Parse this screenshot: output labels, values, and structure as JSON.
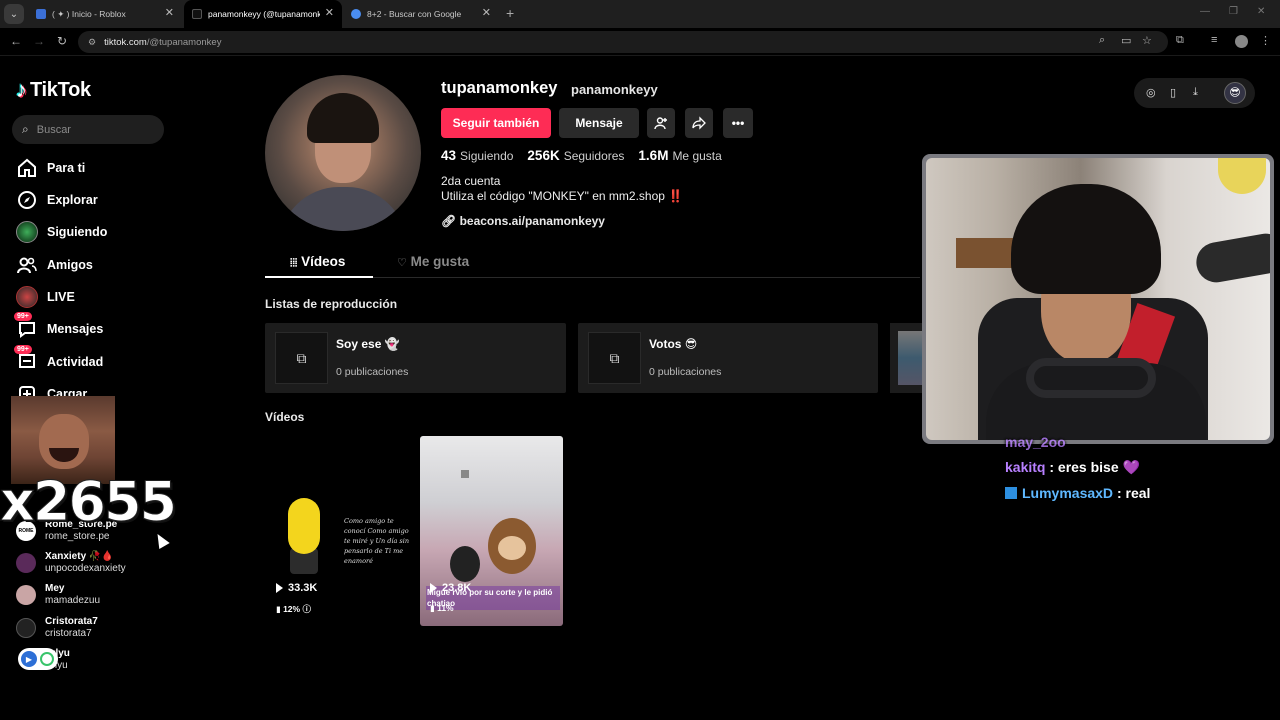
{
  "browser": {
    "tabs": [
      {
        "title": "( ✦ ) Inicio - Roblox",
        "favicon_color": "#3b6fd6"
      },
      {
        "title": "panamonkeyy (@tupanamonkey",
        "favicon_color": "#000000"
      },
      {
        "title": "8+2 - Buscar con Google",
        "favicon_color": "#4a8df0"
      }
    ],
    "url_host": "tiktok.com",
    "url_path": "/@tupanamonkey"
  },
  "sidebar": {
    "logo": "TikTok",
    "search_placeholder": "Buscar",
    "items": [
      {
        "label": "Para ti",
        "icon": "home-icon"
      },
      {
        "label": "Explorar",
        "icon": "compass-icon"
      },
      {
        "label": "Siguiendo",
        "icon": "following-avatar-icon"
      },
      {
        "label": "Amigos",
        "icon": "friends-icon"
      },
      {
        "label": "LIVE",
        "icon": "live-icon"
      },
      {
        "label": "Mensajes",
        "icon": "messages-icon",
        "badge": "99+"
      },
      {
        "label": "Actividad",
        "icon": "activity-icon",
        "badge": "99+"
      },
      {
        "label": "Cargar",
        "icon": "upload-icon"
      }
    ],
    "following": [
      {
        "name": "Rome_store.pe",
        "handle": "rome_store.pe",
        "color": "#ffffff"
      },
      {
        "name": "Xanxiety 🥀🩸",
        "handle": "unpocodexanxiety",
        "color": "#5a2a5a"
      },
      {
        "name": "Mey",
        "handle": "mamadezuu",
        "color": "#c9a5a5"
      },
      {
        "name": "Cristorata7",
        "handle": "cristorata7",
        "color": "#222222"
      },
      {
        "name": "arlyu",
        "handle": "arlyu",
        "color": "#444444"
      }
    ]
  },
  "overlay": {
    "counter": "x2655"
  },
  "profile": {
    "username": "tupanamonkey",
    "nickname": "panamonkeyy",
    "follow_label": "Seguir también",
    "message_label": "Mensaje",
    "stats": {
      "following_count": "43",
      "following_label": "Siguiendo",
      "followers_count": "256K",
      "followers_label": "Seguidores",
      "likes_count": "1.6M",
      "likes_label": "Me gusta"
    },
    "bio_line1": "2da cuenta",
    "bio_line2": "Utiliza el código \"MONKEY\" en mm2.shop",
    "bio_bang": "‼️",
    "link": "beacons.ai/panamonkeyy",
    "tab_videos": "Vídeos",
    "tab_likes": "Me gusta"
  },
  "playlists": {
    "title": "Listas de reproducción",
    "items": [
      {
        "name": "Soy ese 👻",
        "count": "0 publicaciones"
      },
      {
        "name": "Votos 😎",
        "count": "0 publicaciones"
      }
    ]
  },
  "videos": {
    "title": "Vídeos",
    "items": [
      {
        "views": "33.3K",
        "pct": "12%",
        "caption": "Como amigo te conocí Como amigo te miré y Un día sin pensarlo de Ti me enamoré"
      },
      {
        "views": "23.8K",
        "pct": "11%",
        "caption": "Migue rvió por su corte y le pidió chatiao"
      }
    ]
  },
  "chat": [
    {
      "user": "may_2oo",
      "message": "",
      "color": "#b880ff"
    },
    {
      "user": "kakitq",
      "message": ": eres bise 💜",
      "color": "#b880ff"
    },
    {
      "user": "LumymasaxD",
      "message": ": real",
      "color": "#5fb8ff"
    }
  ]
}
